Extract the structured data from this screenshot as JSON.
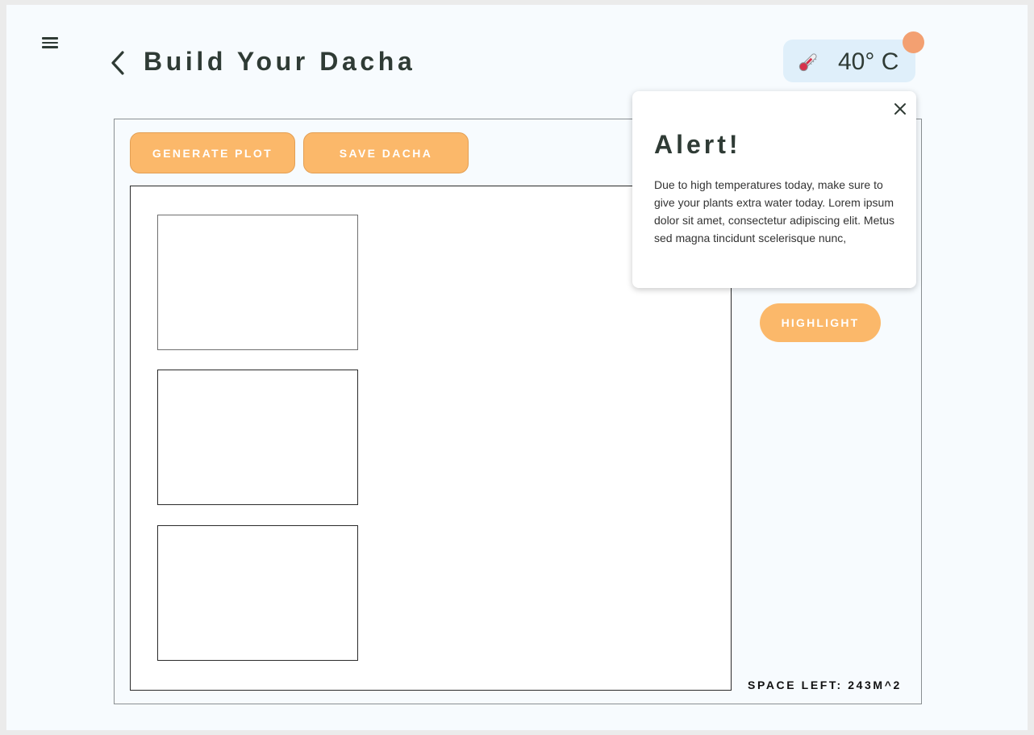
{
  "header": {
    "title": "Build Your Dacha",
    "temperature": "40° C"
  },
  "toolbar": {
    "generate_label": "GENERATE PLOT",
    "save_label": "SAVE DACHA"
  },
  "side_panel": {
    "highlight_label": "HIGHLIGHT",
    "space_left": "SPACE LEFT: 243M^2"
  },
  "alert": {
    "title": "Alert!",
    "body": "Due to high temperatures today, make sure to give your plants extra water today. Lorem ipsum dolor sit amet, consectetur adipiscing elit. Metus sed magna tincidunt scelerisque nunc,"
  },
  "colors": {
    "accent": "#fbb86a",
    "badge": "#f3a071",
    "chip": "#dfeffa",
    "text": "#2f3b35"
  },
  "icons": [
    "menu-icon",
    "back-icon",
    "thermometer-icon",
    "close-icon"
  ]
}
